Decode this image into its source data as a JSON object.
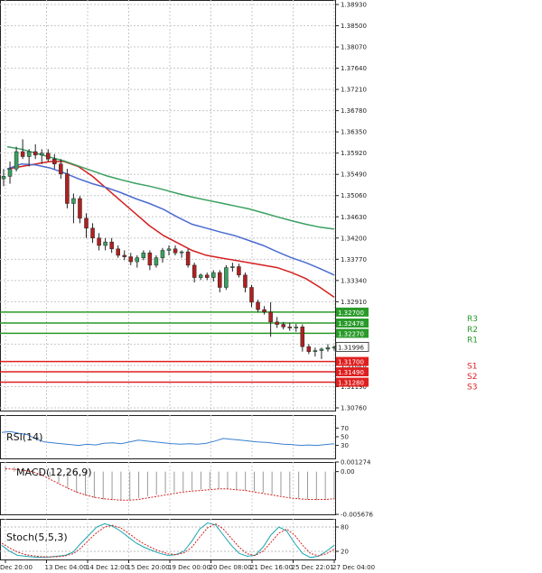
{
  "chart_data": [
    {
      "type": "candlestick",
      "title": "",
      "yaxis_ticks": [
        "1.38930",
        "1.38500",
        "1.38070",
        "1.37640",
        "1.37210",
        "1.36780",
        "1.36350",
        "1.35920",
        "1.35490",
        "1.35060",
        "1.34630",
        "1.34200",
        "1.33770",
        "1.33340",
        "1.32910",
        "1.32480",
        "1.32050",
        "1.31620",
        "1.31190",
        "1.30760"
      ],
      "ylim": [
        1.3076,
        1.3893
      ],
      "xaxis_labels": [
        "Dec 20:00",
        "13 Dec 04:00",
        "14 Dec 12:00",
        "15 Dec 20:00",
        "19 Dec 00:00",
        "20 Dec 08:00",
        "21 Dec 16:00",
        "25 Dec 22:01",
        "27 Dec 04:00"
      ],
      "current_price": "1.31996",
      "candles": [
        [
          1.354,
          1.356,
          1.3525,
          1.3545
        ],
        [
          1.3545,
          1.3575,
          1.353,
          1.356
        ],
        [
          1.356,
          1.3605,
          1.3555,
          1.3595
        ],
        [
          1.3595,
          1.362,
          1.358,
          1.3585
        ],
        [
          1.3585,
          1.36,
          1.3565,
          1.3595
        ],
        [
          1.3595,
          1.361,
          1.358,
          1.3588
        ],
        [
          1.3588,
          1.36,
          1.357,
          1.3592
        ],
        [
          1.3592,
          1.36,
          1.3575,
          1.358
        ],
        [
          1.358,
          1.359,
          1.356,
          1.357
        ],
        [
          1.357,
          1.358,
          1.354,
          1.355
        ],
        [
          1.355,
          1.356,
          1.348,
          1.349
        ],
        [
          1.349,
          1.351,
          1.345,
          1.35
        ],
        [
          1.35,
          1.3505,
          1.345,
          1.346
        ],
        [
          1.346,
          1.347,
          1.342,
          1.344
        ],
        [
          1.344,
          1.345,
          1.341,
          1.342
        ],
        [
          1.342,
          1.343,
          1.3395,
          1.3405
        ],
        [
          1.3405,
          1.342,
          1.3395,
          1.3412
        ],
        [
          1.3412,
          1.342,
          1.339,
          1.3398
        ],
        [
          1.3398,
          1.3405,
          1.338,
          1.3385
        ],
        [
          1.3385,
          1.3395,
          1.3375,
          1.3382
        ],
        [
          1.3382,
          1.339,
          1.3365,
          1.3372
        ],
        [
          1.3372,
          1.3385,
          1.336,
          1.338
        ],
        [
          1.338,
          1.3395,
          1.3375,
          1.339
        ],
        [
          1.339,
          1.3395,
          1.3355,
          1.3365
        ],
        [
          1.3365,
          1.3385,
          1.336,
          1.338
        ],
        [
          1.338,
          1.34,
          1.337,
          1.3395
        ],
        [
          1.3395,
          1.3405,
          1.3385,
          1.3398
        ],
        [
          1.3398,
          1.3405,
          1.3385,
          1.339
        ],
        [
          1.339,
          1.3395,
          1.338,
          1.3392
        ],
        [
          1.3392,
          1.3398,
          1.336,
          1.3365
        ],
        [
          1.3365,
          1.337,
          1.333,
          1.334
        ],
        [
          1.334,
          1.3348,
          1.3335,
          1.3345
        ],
        [
          1.3345,
          1.335,
          1.3335,
          1.334
        ],
        [
          1.334,
          1.3355,
          1.3332,
          1.335
        ],
        [
          1.335,
          1.3355,
          1.331,
          1.332
        ],
        [
          1.332,
          1.3365,
          1.3315,
          1.336
        ],
        [
          1.336,
          1.337,
          1.3352,
          1.3362
        ],
        [
          1.3362,
          1.3368,
          1.334,
          1.3345
        ],
        [
          1.3345,
          1.335,
          1.331,
          1.332
        ],
        [
          1.332,
          1.3325,
          1.328,
          1.329
        ],
        [
          1.329,
          1.3295,
          1.327,
          1.3275
        ],
        [
          1.3275,
          1.3282,
          1.3265,
          1.327
        ],
        [
          1.327,
          1.329,
          1.322,
          1.325
        ],
        [
          1.325,
          1.326,
          1.3238,
          1.3245
        ],
        [
          1.3245,
          1.325,
          1.3235,
          1.324
        ],
        [
          1.324,
          1.3248,
          1.3232,
          1.3238
        ],
        [
          1.3238,
          1.3246,
          1.323,
          1.324
        ],
        [
          1.324,
          1.3245,
          1.319,
          1.32
        ],
        [
          1.32,
          1.3205,
          1.3185,
          1.319
        ],
        [
          1.319,
          1.3198,
          1.318,
          1.3192
        ],
        [
          1.3192,
          1.3198,
          1.3175,
          1.3195
        ],
        [
          1.3195,
          1.3205,
          1.319,
          1.3198
        ],
        [
          1.3198,
          1.3202,
          1.3192,
          1.3199
        ]
      ],
      "moving_averages": [
        {
          "color": "#d42020",
          "values": [
            1.356,
            1.3565,
            1.357,
            1.3575,
            1.3575,
            1.3565,
            1.3545,
            1.352,
            1.3495,
            1.347,
            1.3445,
            1.3425,
            1.341,
            1.3395,
            1.3385,
            1.338,
            1.3375,
            1.337,
            1.3365,
            1.336,
            1.335,
            1.3338,
            1.332,
            1.33
          ]
        },
        {
          "color": "#4a6cd0",
          "values": [
            1.356,
            1.357,
            1.3568,
            1.3562,
            1.3552,
            1.354,
            1.353,
            1.3522,
            1.3512,
            1.35,
            1.349,
            1.3478,
            1.3462,
            1.3448,
            1.344,
            1.3432,
            1.3425,
            1.3415,
            1.3405,
            1.3392,
            1.338,
            1.337,
            1.3358,
            1.3345
          ]
        },
        {
          "color": "#3aa060",
          "values": [
            1.3605,
            1.36,
            1.3592,
            1.3584,
            1.3576,
            1.3566,
            1.3556,
            1.3546,
            1.3538,
            1.3531,
            1.3525,
            1.3518,
            1.351,
            1.3503,
            1.3497,
            1.3491,
            1.3485,
            1.3479,
            1.3471,
            1.3463,
            1.3455,
            1.3448,
            1.3442,
            1.3438
          ]
        }
      ],
      "levels": [
        {
          "name": "R3",
          "value": "1.32700",
          "color": "#2a9a2a"
        },
        {
          "name": "R2",
          "value": "1.32478",
          "color": "#2a9a2a"
        },
        {
          "name": "R1",
          "value": "1.32270",
          "color": "#2a9a2a"
        },
        {
          "name": "S1",
          "value": "1.31700",
          "color": "#e02020"
        },
        {
          "name": "S2",
          "value": "1.31490",
          "color": "#e02020"
        },
        {
          "name": "S3",
          "value": "1.31280",
          "color": "#e02020"
        }
      ]
    },
    {
      "type": "line",
      "title": "RSI(14)",
      "yaxis_ticks": [
        "70",
        "50",
        "30"
      ],
      "ylim": [
        0,
        100
      ],
      "series": [
        {
          "color": "#3a7fd0",
          "values": [
            60,
            62,
            58,
            55,
            45,
            38,
            36,
            34,
            32,
            30,
            33,
            31,
            35,
            36,
            34,
            38,
            42,
            40,
            38,
            36,
            34,
            33,
            34,
            33,
            35,
            40,
            46,
            44,
            42,
            40,
            38,
            37,
            35,
            33,
            32,
            30,
            31,
            30,
            32,
            34
          ]
        }
      ]
    },
    {
      "type": "histogram",
      "title": "MACD(12,26,9)",
      "yaxis_ticks": [
        "0.001274",
        "0.00",
        "-0.005676"
      ],
      "ylim": [
        -0.005676,
        0.001274
      ],
      "values": [
        0.0007,
        0.0006,
        0.0004,
        0.0002,
        -0.0002,
        -0.0008,
        -0.0015,
        -0.0022,
        -0.0028,
        -0.0032,
        -0.0035,
        -0.0037,
        -0.0038,
        -0.0038,
        -0.0037,
        -0.0035,
        -0.0033,
        -0.0031,
        -0.0029,
        -0.0027,
        -0.0026,
        -0.0025,
        -0.0024,
        -0.0023,
        -0.0023,
        -0.0023,
        -0.0024,
        -0.0025,
        -0.0026,
        -0.0028,
        -0.003,
        -0.0032,
        -0.0034,
        -0.0036,
        -0.0037,
        -0.0038,
        -0.0038,
        -0.0037
      ],
      "signal": [
        0.0004,
        0.0003,
        0.0002,
        0.0,
        -0.0004,
        -0.001,
        -0.0016,
        -0.0022,
        -0.0027,
        -0.0031,
        -0.0034,
        -0.0036,
        -0.0037,
        -0.0038,
        -0.0038,
        -0.0037,
        -0.0035,
        -0.0033,
        -0.0031,
        -0.0029,
        -0.0027,
        -0.0026,
        -0.0025,
        -0.0024,
        -0.0023,
        -0.0023,
        -0.0024,
        -0.0025,
        -0.0027,
        -0.0029,
        -0.0031,
        -0.0033,
        -0.0035,
        -0.0036,
        -0.0037,
        -0.0037,
        -0.0037,
        -0.0036
      ],
      "signal_color": "#d42020",
      "bar_color": "#9a9a9a"
    },
    {
      "type": "line",
      "title": "Stoch(5,5,3)",
      "yaxis_ticks": [
        "80",
        "20"
      ],
      "ylim": [
        0,
        100
      ],
      "series": [
        {
          "color": "#1aa6b0",
          "values": [
            35,
            20,
            10,
            8,
            6,
            5,
            6,
            8,
            10,
            18,
            40,
            60,
            80,
            88,
            82,
            70,
            55,
            40,
            30,
            22,
            15,
            10,
            12,
            20,
            45,
            75,
            90,
            85,
            60,
            35,
            15,
            8,
            10,
            30,
            60,
            80,
            70,
            40,
            15,
            5,
            8,
            20,
            35
          ]
        },
        {
          "color": "#d42020",
          "values": [
            40,
            28,
            18,
            12,
            9,
            7,
            6,
            7,
            9,
            14,
            28,
            48,
            66,
            80,
            84,
            78,
            65,
            50,
            38,
            28,
            20,
            14,
            12,
            16,
            30,
            55,
            78,
            88,
            75,
            52,
            30,
            14,
            10,
            20,
            42,
            65,
            75,
            60,
            35,
            15,
            9,
            14,
            25
          ]
        }
      ]
    }
  ]
}
